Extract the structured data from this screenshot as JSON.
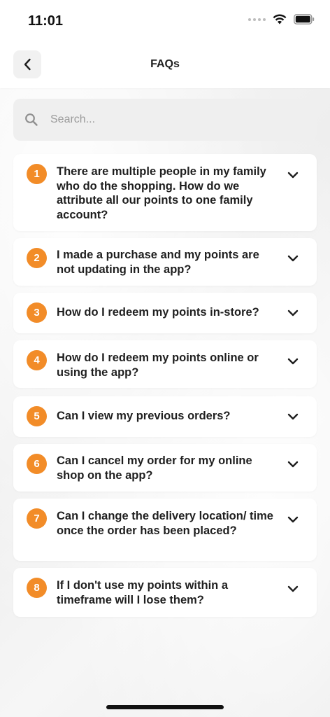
{
  "status_bar": {
    "time": "11:01"
  },
  "header": {
    "title": "FAQs"
  },
  "search": {
    "placeholder": "Search..."
  },
  "faqs": [
    {
      "number": "1",
      "question": "There are multiple people in my family who do the shopping. How do we attribute all our points to one family account?"
    },
    {
      "number": "2",
      "question": "I made a purchase and my points are not updating in the app?"
    },
    {
      "number": "3",
      "question": "How do I redeem my points in-store?"
    },
    {
      "number": "4",
      "question": "How do I redeem my points online or using the app?"
    },
    {
      "number": "5",
      "question": "Can I view my previous orders?"
    },
    {
      "number": "6",
      "question": "Can I cancel my order for my online shop on the app?"
    },
    {
      "number": "7",
      "question": "Can I change the delivery location/ time once the order has been placed?"
    },
    {
      "number": "8",
      "question": "If I don't use my points within a timeframe will I lose them?"
    }
  ],
  "colors": {
    "accent": "#f28c28",
    "card": "#ffffff",
    "search_bg": "#efefef"
  },
  "icons": {
    "back": "chevron-left-icon",
    "search": "search-icon",
    "expand": "chevron-down-icon"
  }
}
